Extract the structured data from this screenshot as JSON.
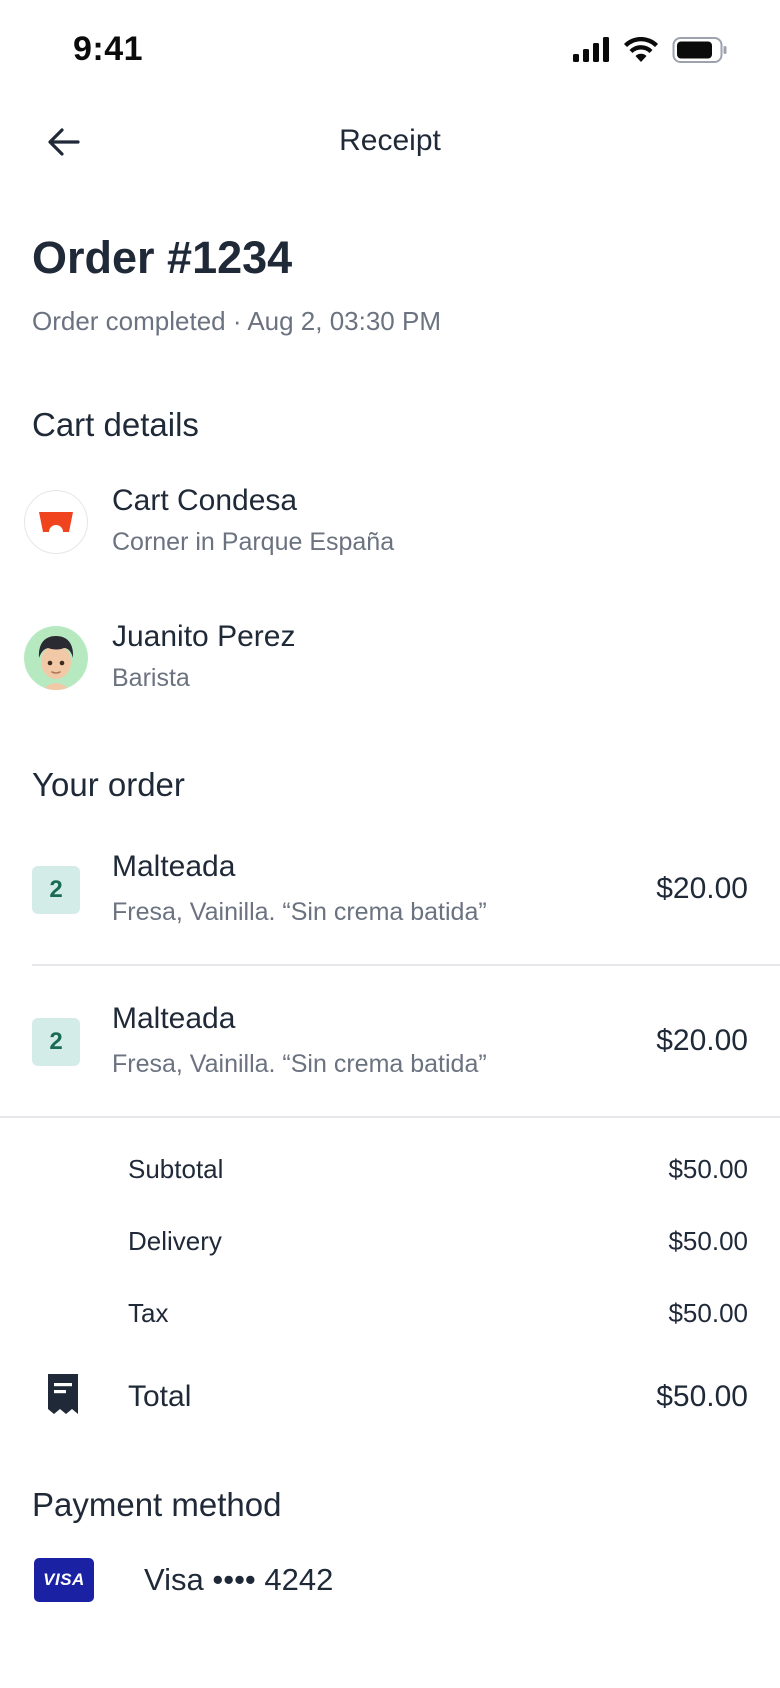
{
  "status_bar": {
    "time": "9:41",
    "icons": [
      "cellular-signal-icon",
      "wifi-icon",
      "battery-icon"
    ]
  },
  "nav": {
    "title": "Receipt",
    "back_icon": "arrow-left-icon"
  },
  "order": {
    "title": "Order #1234",
    "subtitle": "Order completed · Aug 2, 03:30 PM"
  },
  "cart_details": {
    "heading": "Cart details",
    "cart": {
      "name": "Cart Condesa",
      "location": "Corner in Parque España",
      "icon": "cart-logo-icon"
    },
    "barista": {
      "name": "Juanito Perez",
      "role": "Barista",
      "icon": "barista-avatar"
    }
  },
  "your_order": {
    "heading": "Your order",
    "items": [
      {
        "qty": "2",
        "name": "Malteada",
        "description": "Fresa, Vainilla. “Sin crema batida”",
        "price": "$20.00"
      },
      {
        "qty": "2",
        "name": "Malteada",
        "description": "Fresa, Vainilla. “Sin crema batida”",
        "price": "$20.00"
      }
    ]
  },
  "summary": {
    "subtotal_label": "Subtotal",
    "subtotal_value": "$50.00",
    "delivery_label": "Delivery",
    "delivery_value": "$50.00",
    "tax_label": "Tax",
    "tax_value": "$50.00",
    "total_label": "Total",
    "total_value": "$50.00",
    "total_icon": "receipt-icon"
  },
  "payment": {
    "heading": "Payment method",
    "card_brand": "VISA",
    "card_text": "Visa •••• 4242"
  },
  "colors": {
    "text_primary": "#1f2937",
    "text_secondary": "#6b7280",
    "badge_bg": "#d4ece7",
    "badge_text": "#1a6b55",
    "cart_logo": "#f0441f",
    "avatar_bg": "#b7e9c1",
    "visa_blue": "#1a22a3"
  }
}
